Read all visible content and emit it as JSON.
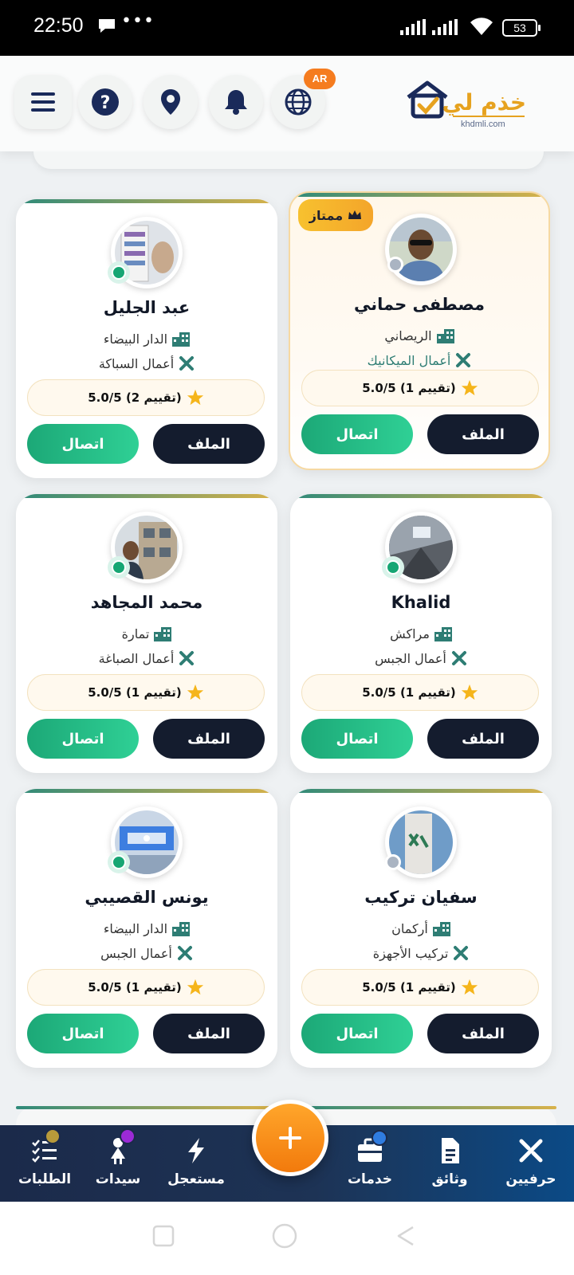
{
  "status_bar": {
    "time": "22:50",
    "battery": "53"
  },
  "header": {
    "lang_badge": "AR",
    "logo_text": "خذم لي",
    "logo_domain": "khdmli.com"
  },
  "cards": [
    {
      "name": "مصطفى حماني",
      "city": "الريصاني",
      "trade": "أعمال الميكانيك",
      "rating": "5.0/5 (1 تقييم)",
      "profile_label": "الملف",
      "call_label": "اتصال",
      "badge": "ممتاز",
      "online": false
    },
    {
      "name": "عبد الجليل",
      "city": "الدار البيضاء",
      "trade": "أعمال السباكة",
      "rating": "5.0/5 (2 تقييم)",
      "profile_label": "الملف",
      "call_label": "اتصال",
      "online": true
    },
    {
      "name": "Khalid",
      "city": "مراكش",
      "trade": "أعمال الجبس",
      "rating": "5.0/5 (1 تقييم)",
      "profile_label": "الملف",
      "call_label": "اتصال",
      "online": true
    },
    {
      "name": "محمد المجاهد",
      "city": "تمارة",
      "trade": "أعمال الصباغة",
      "rating": "5.0/5 (1 تقييم)",
      "profile_label": "الملف",
      "call_label": "اتصال",
      "online": true
    },
    {
      "name": "سفيان تركيب",
      "city": "أركمان",
      "trade": "تركيب الأجهزة",
      "rating": "5.0/5 (1 تقييم)",
      "profile_label": "الملف",
      "call_label": "اتصال",
      "online": false
    },
    {
      "name": "يونس القصيبي",
      "city": "الدار البيضاء",
      "trade": "أعمال الجبس",
      "rating": "5.0/5 (1 تقييم)",
      "profile_label": "الملف",
      "call_label": "اتصال",
      "online": true
    }
  ],
  "bottom_nav": {
    "items": [
      {
        "label": "حرفيين",
        "icon": "tools-icon"
      },
      {
        "label": "وثائق",
        "icon": "document-icon"
      },
      {
        "label": "خدمات",
        "icon": "briefcase-icon"
      },
      {
        "label": "مستعجل",
        "icon": "lightning-icon"
      },
      {
        "label": "سيدات",
        "icon": "woman-icon"
      },
      {
        "label": "الطلبات",
        "icon": "task-list-icon"
      }
    ]
  },
  "colors": {
    "accent_green": "#1ca877",
    "dark_button": "#141c2e",
    "premium_gold": "#f7c12f",
    "fab_orange": "#f5840f",
    "nav_bg": "#1b2a4a"
  }
}
